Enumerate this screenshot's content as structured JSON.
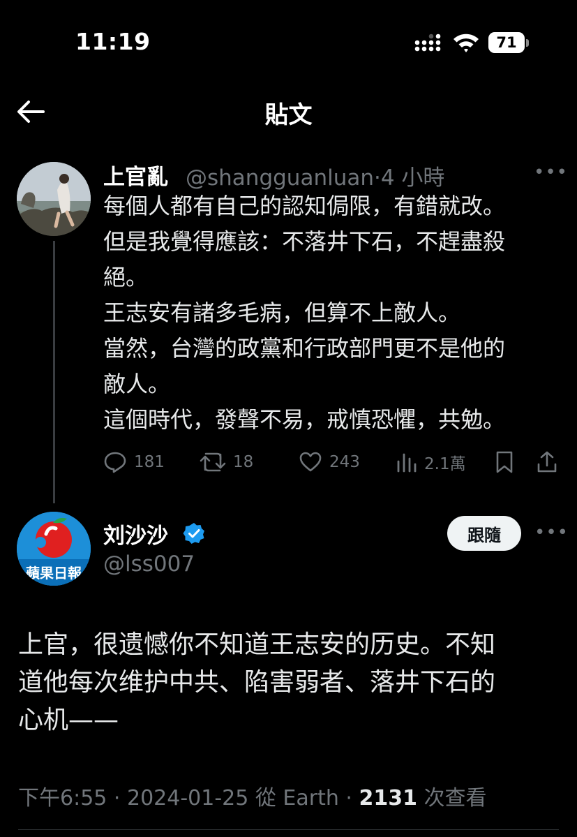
{
  "status_bar": {
    "time": "11:19",
    "battery": "71"
  },
  "header": {
    "title": "貼文"
  },
  "original_tweet": {
    "author_name": "上官亂",
    "author_handle": "@shangguanluan",
    "separator": "·",
    "time_ago": "4 小時",
    "lines": [
      "每個人都有自己的認知侷限，有錯就改。",
      "但是我覺得應該：不落井下石，不趕盡殺",
      "絕。",
      "王志安有諸多毛病，但算不上敵人。",
      "當然，台灣的政黨和行政部門更不是他的",
      "敵人。",
      "這個時代，發聲不易，戒慎恐懼，共勉。"
    ],
    "stats": {
      "replies": "181",
      "retweets": "18",
      "likes": "243",
      "views": "2.1萬"
    }
  },
  "reply_tweet": {
    "author_name": "刘沙沙",
    "author_handle": "@lss007",
    "avatar_text": "蘋果日報",
    "follow_label": "跟隨",
    "lines": [
      "上官，很遗憾你不知道王志安的历史。不知",
      "道他每次维护中共、陷害弱者、落井下石的",
      "心机——"
    ],
    "timestamp": "下午6:55",
    "date": "2024-01-25",
    "source": "從 Earth",
    "view_count": "2131",
    "view_label": "次查看"
  },
  "colors": {
    "background": "#000000",
    "text": "#e7e9ea",
    "secondary": "#71767b",
    "verified": "#1d9bf0"
  }
}
